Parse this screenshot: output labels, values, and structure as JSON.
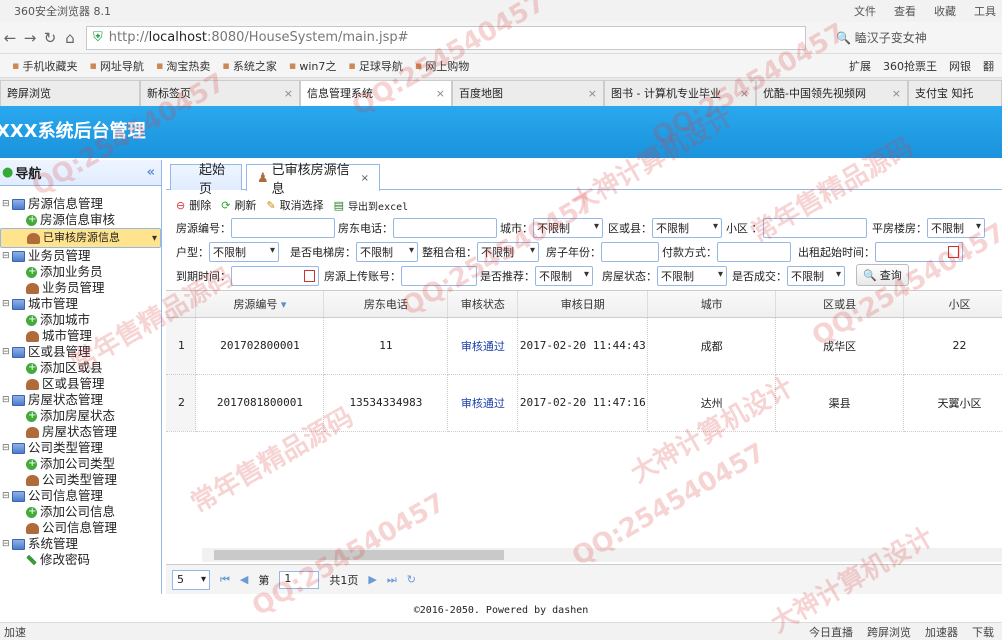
{
  "browser": {
    "title": "360安全浏览器 8.1",
    "menus": [
      "文件",
      "查看",
      "收藏",
      "工具"
    ],
    "url_prefix": "http://",
    "url_host": "localhost",
    "url_rest": ":8080/HouseSystem/main.jsp#",
    "search": "瞌汉子变女神"
  },
  "bookmarks": [
    "手机收藏夹",
    "网址导航",
    "淘宝热卖",
    "系统之家",
    "win7之",
    "足球导航",
    "网上购物"
  ],
  "bookmarks_right": [
    "扩展",
    "360抢票王",
    "网银",
    "翻"
  ],
  "tabs": [
    "跨屏浏览",
    "新标签页",
    "信息管理系统",
    "百度地图",
    "图书 - 计算机专业毕业",
    "优酷-中国领先视频网",
    "支付宝 知托"
  ],
  "header_title": "XXX系统后台管理",
  "nav": {
    "title": "导航",
    "groups": [
      {
        "label": "房源信息管理",
        "items": [
          {
            "label": "房源信息审核",
            "icon": "plus"
          },
          {
            "label": "已审核房源信息",
            "icon": "user",
            "selected": true
          }
        ]
      },
      {
        "label": "业务员管理",
        "items": [
          {
            "label": "添加业务员",
            "icon": "plus"
          },
          {
            "label": "业务员管理",
            "icon": "user"
          }
        ]
      },
      {
        "label": "城市管理",
        "items": [
          {
            "label": "添加城市",
            "icon": "plus"
          },
          {
            "label": "城市管理",
            "icon": "user"
          }
        ]
      },
      {
        "label": "区或县管理",
        "items": [
          {
            "label": "添加区或县",
            "icon": "plus"
          },
          {
            "label": "区或县管理",
            "icon": "user"
          }
        ]
      },
      {
        "label": "房屋状态管理",
        "items": [
          {
            "label": "添加房屋状态",
            "icon": "plus"
          },
          {
            "label": "房屋状态管理",
            "icon": "user"
          }
        ]
      },
      {
        "label": "公司类型管理",
        "items": [
          {
            "label": "添加公司类型",
            "icon": "plus"
          },
          {
            "label": "公司类型管理",
            "icon": "user"
          }
        ]
      },
      {
        "label": "公司信息管理",
        "items": [
          {
            "label": "添加公司信息",
            "icon": "plus"
          },
          {
            "label": "公司信息管理",
            "icon": "user"
          }
        ]
      },
      {
        "label": "系统管理",
        "items": [
          {
            "label": "修改密码",
            "icon": "pen"
          }
        ]
      }
    ]
  },
  "content_tabs": [
    "起始页",
    "已审核房源信息"
  ],
  "toolbar": {
    "delete": "删除",
    "refresh": "刷新",
    "cancel": "取消选择",
    "export": "导出到excel"
  },
  "filters": {
    "house_no": "房源编号：",
    "phone": "房东电话：",
    "city": "城市：",
    "district": "区或县：",
    "community": "小区 ：",
    "flat": "平房楼房：",
    "type": "户型：",
    "elevator": "是否电梯房：",
    "whole": "整租合租：",
    "age": "房子年份：",
    "pay": "付款方式：",
    "rent_start": "出租起始时间：",
    "expire": "到期时间：",
    "uploader": "房源上传账号：",
    "recommend": "是否推荐：",
    "state": "房屋状态：",
    "deal": "是否成交：",
    "unlimited": "不限制",
    "query": "查询"
  },
  "columns": [
    "房源编号",
    "房东电话",
    "审核状态",
    "审核日期",
    "城市",
    "区或县",
    "小区"
  ],
  "rows": [
    {
      "num": "1",
      "house_no": "201702800001",
      "phone": "11",
      "status": "审核通过",
      "date": "2017-02-20 11:44:43",
      "city": "成都",
      "district": "成华区",
      "community": "22"
    },
    {
      "num": "2",
      "house_no": "2017081800001",
      "phone": "13534334983",
      "status": "审核通过",
      "date": "2017-02-20 11:47:16",
      "city": "达州",
      "district": "渠县",
      "community": "天翼小区"
    }
  ],
  "pager": {
    "size": "5",
    "page_label": "第",
    "page": "1",
    "total": "共1页"
  },
  "footer": "©2016-2050. Powered by dashen",
  "statusbar": {
    "left": "加速",
    "items": [
      "今日直播",
      "跨屏浏览",
      "加速器",
      "下载"
    ]
  },
  "watermarks": [
    "QQ:254540457",
    "大神计算机设计",
    "常年售精品源码"
  ]
}
